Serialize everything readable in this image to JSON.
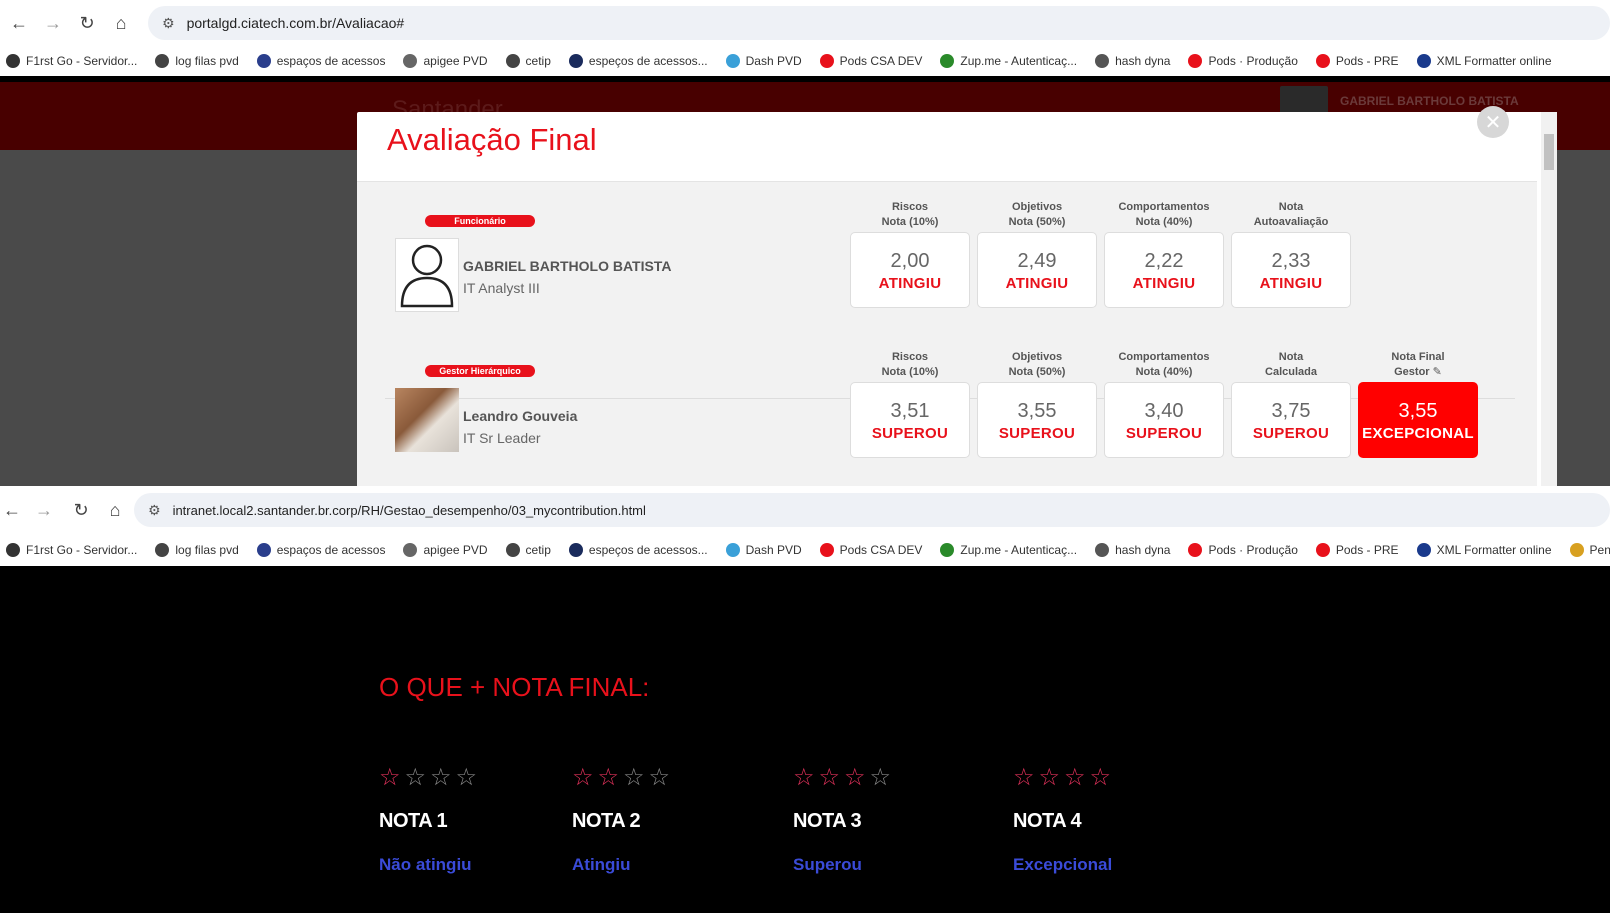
{
  "browser1": {
    "url": "portalgd.ciatech.com.br/Avaliacao#",
    "bookmarks": [
      "F1rst Go - Servidor...",
      "log filas pvd",
      "espaços de acessos",
      "apigee PVD",
      "cetip",
      "espeços de acessos...",
      "Dash PVD",
      "Pods CSA DEV",
      "Zup.me - Autenticaç...",
      "hash dyna",
      "Pods · Produção",
      "Pods - PRE",
      "XML Formatter online"
    ]
  },
  "header": {
    "logo": "Santander",
    "user_name": "GABRIEL BARTHOLO BATISTA"
  },
  "modal": {
    "title": "Avaliação Final",
    "close": "✕",
    "employee": {
      "badge": "Funcionário",
      "name": "GABRIEL BARTHOLO BATISTA",
      "role": "IT Analyst III",
      "scores": [
        {
          "h1": "Riscos",
          "h2": "Nota (10%)",
          "value": "2,00",
          "label": "ATINGIU"
        },
        {
          "h1": "Objetivos",
          "h2": "Nota (50%)",
          "value": "2,49",
          "label": "ATINGIU"
        },
        {
          "h1": "Comportamentos",
          "h2": "Nota (40%)",
          "value": "2,22",
          "label": "ATINGIU"
        },
        {
          "h1": "Nota",
          "h2": "Autoavaliação",
          "value": "2,33",
          "label": "ATINGIU"
        }
      ]
    },
    "manager": {
      "badge": "Gestor Hierárquico",
      "name": "Leandro Gouveia",
      "role": "IT Sr Leader",
      "scores": [
        {
          "h1": "Riscos",
          "h2": "Nota (10%)",
          "value": "3,51",
          "label": "SUPEROU"
        },
        {
          "h1": "Objetivos",
          "h2": "Nota (50%)",
          "value": "3,55",
          "label": "SUPEROU"
        },
        {
          "h1": "Comportamentos",
          "h2": "Nota (40%)",
          "value": "3,40",
          "label": "SUPEROU"
        },
        {
          "h1": "Nota",
          "h2": "Calculada",
          "value": "3,75",
          "label": "SUPEROU"
        },
        {
          "h1": "Nota Final",
          "h2": "Gestor ✎",
          "value": "3,55",
          "label": "EXCEPCIONAL"
        }
      ]
    }
  },
  "browser2": {
    "url": "intranet.local2.santander.br.corp/RH/Gestao_desempenho/03_mycontribution.html",
    "bookmarks": [
      "F1rst Go - Servidor...",
      "log filas pvd",
      "espaços de acessos",
      "apigee PVD",
      "cetip",
      "espeços de acessos...",
      "Dash PVD",
      "Pods CSA DEV",
      "Zup.me - Autenticaç...",
      "hash dyna",
      "Pods · Produção",
      "Pods - PRE",
      "XML Formatter online",
      "Pende"
    ]
  },
  "page2": {
    "heading": "O QUE + NOTA FINAL:",
    "ratings": [
      {
        "stars_filled": 1,
        "title": "NOTA 1",
        "desc": "Não atingiu"
      },
      {
        "stars_filled": 2,
        "title": "NOTA 2",
        "desc": "Atingiu"
      },
      {
        "stars_filled": 3,
        "title": "NOTA 3",
        "desc": "Superou"
      },
      {
        "stars_filled": 4,
        "title": "NOTA 4",
        "desc": "Excepcional"
      }
    ]
  },
  "colors": {
    "accent_red": "#e8111b",
    "final_red": "#ff0000",
    "star_pink": "#e0315a",
    "link_blue": "#3a4bd8"
  }
}
